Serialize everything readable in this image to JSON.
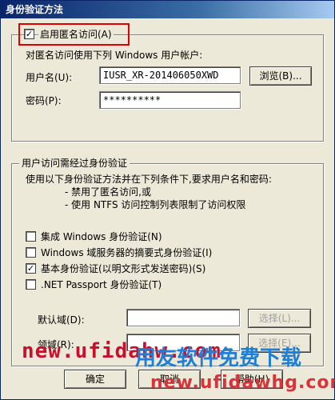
{
  "window": {
    "title": "身份验证方法"
  },
  "anonymous": {
    "enable_label": "启用匿名访问(A)",
    "enabled": true,
    "description": "对匿名访问使用下列 Windows 用户帐户:",
    "username_label": "用户名(U):",
    "username_value": "IUSR_XR-201406050XWD",
    "browse_label": "浏览(B)...",
    "password_label": "密码(P):",
    "password_value": "**********"
  },
  "auth": {
    "group_title": "用户访问需经过身份验证",
    "desc_line1": "使用以下身份验证方法并在下列条件下,要求用户名和密码:",
    "desc_line2": "- 禁用了匿名访问,或",
    "desc_line3": "- 使用 NTFS 访问控制列表限制了访问权限",
    "options": [
      {
        "label": "集成 Windows 身份验证(N)",
        "checked": false
      },
      {
        "label": "Windows 域服务器的摘要式身份验证(I)",
        "checked": false
      },
      {
        "label": "基本身份验证(以明文形式发送密码)(S)",
        "checked": true
      },
      {
        "label": ".NET Passport 身份验证(T)",
        "checked": false
      }
    ],
    "default_domain_label": "默认域(D):",
    "default_domain_value": "",
    "select1_label": "选择(L)...",
    "realm_label": "领域(R):",
    "realm_value": "",
    "select2_label": "选择(E)..."
  },
  "buttons": {
    "ok": "确定",
    "cancel": "取消",
    "help": "帮助(H)"
  },
  "watermark": {
    "line1": "new.ufidahw.com",
    "line2": "用友软件免费下载",
    "line3": "new.ufidawhg.com"
  },
  "check_glyph": "✓",
  "colors": {
    "highlight": "#e00000",
    "watermark_red": "#c8102e",
    "watermark_blue": "#1e7fd8",
    "titlebar": "#0a246a"
  }
}
